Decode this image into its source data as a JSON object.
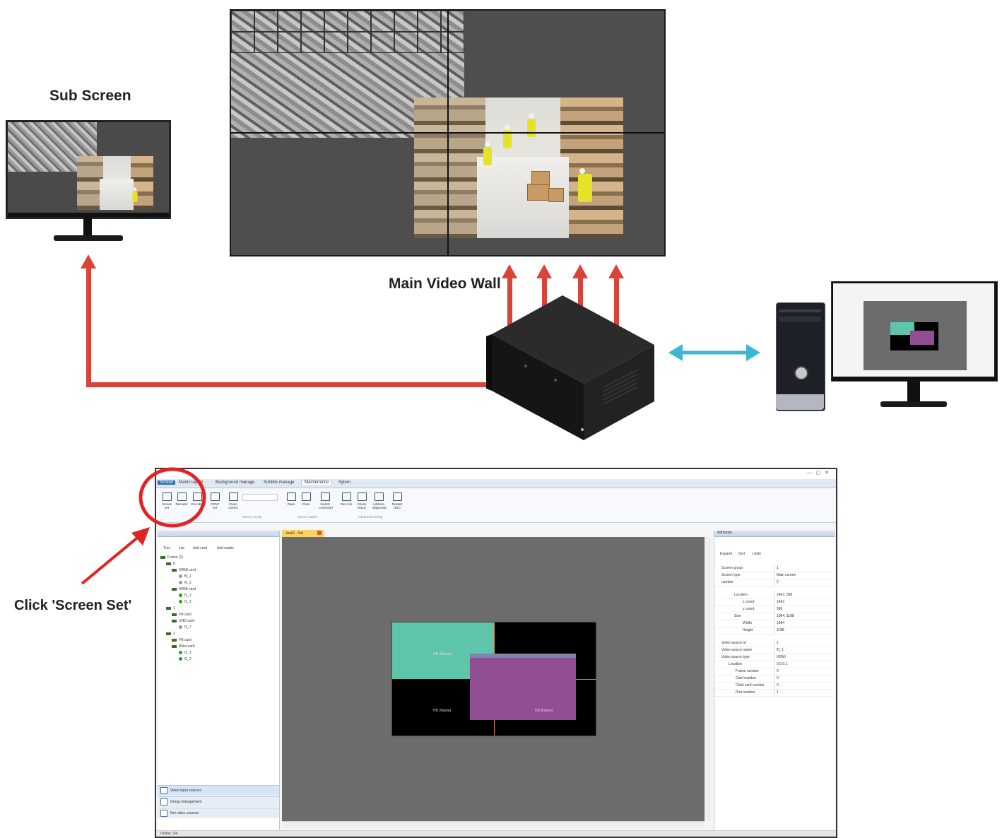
{
  "labels": {
    "sub_screen": "Sub Screen",
    "main_video_wall": "Main Video Wall",
    "click_screen_set": "Click 'Screen Set'"
  },
  "colors": {
    "signal_arrow": "#d9433a",
    "control_arrow": "#3db6d6",
    "highlight_circle": "#e02424",
    "window_teal": "#5ec5ab",
    "window_purple": "#924e95"
  },
  "icons": {
    "device": "video-wall-controller-icon",
    "pc": "desktop-computer-icon",
    "monitor": "monitor-icon"
  },
  "app": {
    "menu_tabs": [
      "Screen",
      "Matrix layout",
      "Background manage",
      "Subtitle manage",
      "Maintenance",
      "Sytem"
    ],
    "active_tab": "Maintenance",
    "ribbon_buttons": [
      "Screen set",
      "Decoder",
      "Encoder",
      "CONF set",
      "Clean control",
      "Open",
      "Close",
      "Switch command",
      "Run info",
      "Check status",
      "Address diagnostic",
      "Restart (DE)"
    ],
    "ribbon_groups": [
      "Screen config",
      "Screen switch",
      "Advanced setting"
    ],
    "left_toolbar": [
      "Tree",
      "List",
      "Add card",
      "Add matrix"
    ],
    "tree": [
      "Frame (1)",
      "0",
      "HDMI card",
      "f0_1",
      "f0_2",
      "HDMI card",
      "f1_1",
      "f1_2",
      "1",
      "FN card",
      "UHD card",
      "f1_7",
      "2",
      "FN card",
      "RNet card",
      "f2_1",
      "f2_2"
    ],
    "nav_items": [
      "Video input sources",
      "Group management",
      "Net video sources"
    ],
    "canvas_tab": "task2 - Set",
    "window_labels": [
      "HD (Name)",
      "HD (Name)",
      "HD (Name)",
      "HD (Name)"
    ],
    "properties_title": "Attributes",
    "property_tools": [
      "Expand",
      "Sort",
      "Undo"
    ],
    "properties": [
      {
        "k": "Screen group",
        "v": "1"
      },
      {
        "k": "Screen type",
        "v": "Main screen"
      },
      {
        "k": "number",
        "v": "2"
      },
      {
        "k": "Location",
        "v": "1463, 586"
      },
      {
        "k": "x coord",
        "v": "1463"
      },
      {
        "k": "y coord",
        "v": "586"
      },
      {
        "k": "Size",
        "v": "1984, 1188"
      },
      {
        "k": "Width",
        "v": "1984"
      },
      {
        "k": "Height",
        "v": "1188"
      },
      {
        "k": "Video source id",
        "v": "1"
      },
      {
        "k": "Video source name",
        "v": "f0_1"
      },
      {
        "k": "Video source type",
        "v": "HDMI"
      },
      {
        "k": "Location",
        "v": "0.0.0.1"
      },
      {
        "k": "Frame number",
        "v": "0"
      },
      {
        "k": "Card number",
        "v": "0"
      },
      {
        "k": "Child card number",
        "v": "0"
      },
      {
        "k": "Port number",
        "v": "1"
      }
    ],
    "status": "Online: 3/4"
  }
}
